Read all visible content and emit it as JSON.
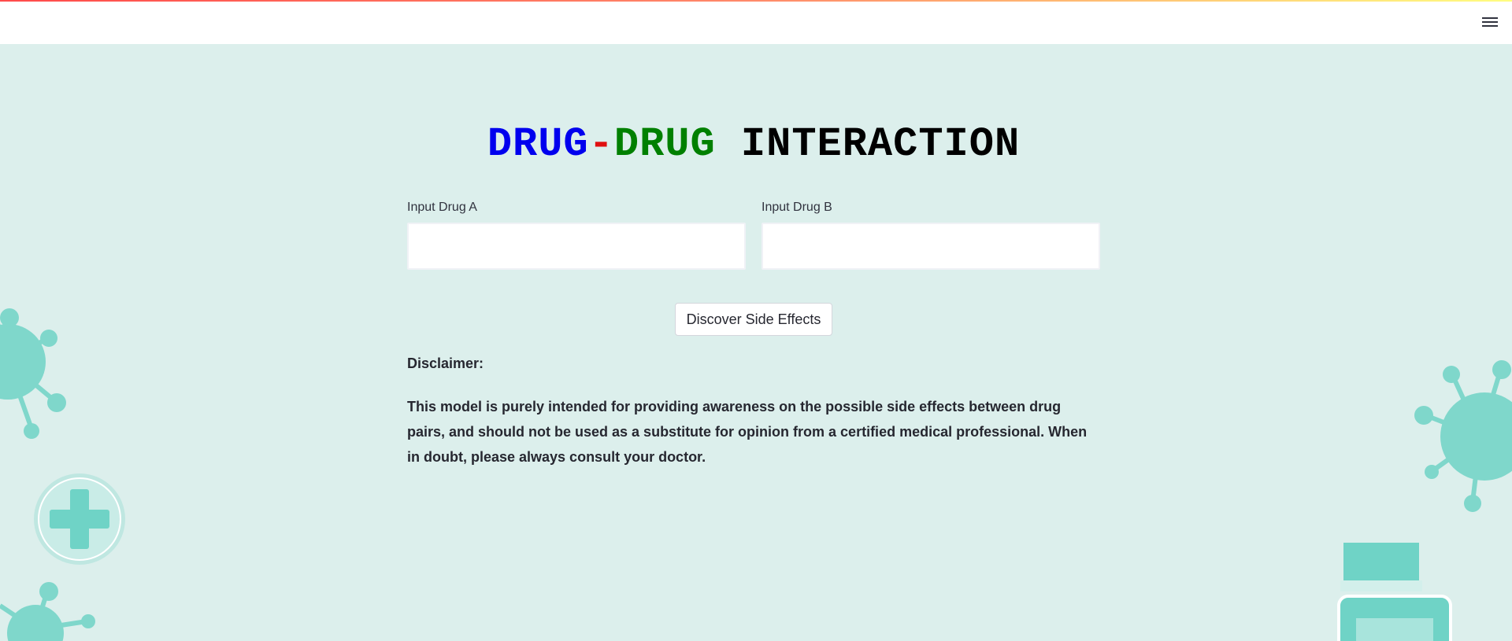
{
  "header": {
    "menu_icon": "hamburger-menu-icon"
  },
  "title": {
    "part1": "DRUG",
    "dash": "-",
    "part2": "DRUG",
    "part3": "INTERACTION"
  },
  "inputs": {
    "drug_a": {
      "label": "Input Drug A",
      "value": "",
      "placeholder": ""
    },
    "drug_b": {
      "label": "Input Drug B",
      "value": "",
      "placeholder": ""
    }
  },
  "actions": {
    "discover_label": "Discover Side Effects"
  },
  "disclaimer": {
    "heading": "Disclaimer:",
    "text": "This model is purely intended for providing awareness on the possible side effects between drug pairs, and should not be used as a substitute for opinion from a certified medical professional. When in doubt, please always consult your doctor."
  },
  "colors": {
    "background": "#dcefec",
    "accent_teal": "#6fd3c6",
    "title_blue": "#0000ee",
    "title_red": "#e01010",
    "title_green": "#008000"
  },
  "background_icons": [
    "virus-icon",
    "medical-cross-icon",
    "medicine-bottle-icon"
  ]
}
